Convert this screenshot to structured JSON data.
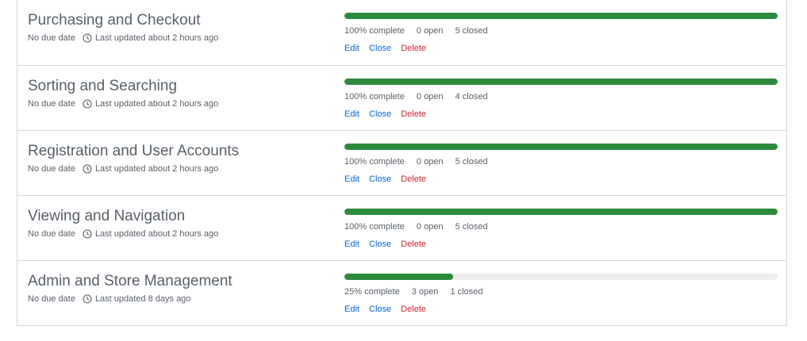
{
  "colors": {
    "progress_fill": "#2c8a3c",
    "progress_track": "#eeeeee",
    "link": "#0366d6",
    "danger": "#cb2431",
    "muted_text": "#586069"
  },
  "milestones": [
    {
      "title": "Purchasing and Checkout",
      "due": "No due date",
      "updated": "Last updated about 2 hours ago",
      "percent": 100,
      "complete_label": "100% complete",
      "open_label": "0 open",
      "closed_label": "5 closed",
      "edit_label": "Edit",
      "close_label": "Close",
      "delete_label": "Delete"
    },
    {
      "title": "Sorting and Searching",
      "due": "No due date",
      "updated": "Last updated about 2 hours ago",
      "percent": 100,
      "complete_label": "100% complete",
      "open_label": "0 open",
      "closed_label": "4 closed",
      "edit_label": "Edit",
      "close_label": "Close",
      "delete_label": "Delete"
    },
    {
      "title": "Registration and User Accounts",
      "due": "No due date",
      "updated": "Last updated about 2 hours ago",
      "percent": 100,
      "complete_label": "100% complete",
      "open_label": "0 open",
      "closed_label": "5 closed",
      "edit_label": "Edit",
      "close_label": "Close",
      "delete_label": "Delete"
    },
    {
      "title": "Viewing and Navigation",
      "due": "No due date",
      "updated": "Last updated about 2 hours ago",
      "percent": 100,
      "complete_label": "100% complete",
      "open_label": "0 open",
      "closed_label": "5 closed",
      "edit_label": "Edit",
      "close_label": "Close",
      "delete_label": "Delete"
    },
    {
      "title": "Admin and Store Management",
      "due": "No due date",
      "updated": "Last updated 8 days ago",
      "percent": 25,
      "complete_label": "25% complete",
      "open_label": "3 open",
      "closed_label": "1 closed",
      "edit_label": "Edit",
      "close_label": "Close",
      "delete_label": "Delete"
    }
  ]
}
